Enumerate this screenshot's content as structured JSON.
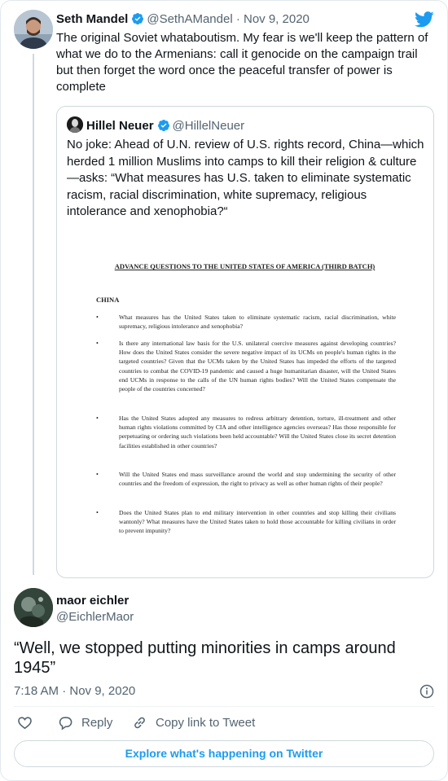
{
  "colors": {
    "accent": "#1d9bf0",
    "muted": "#536471",
    "text": "#0f1419",
    "border": "#cfd9de"
  },
  "parent_tweet": {
    "avatar_icon": "seth-mandel-avatar",
    "name": "Seth Mandel",
    "handle": "@SethAMandel",
    "dot": "·",
    "date": "Nov 9, 2020",
    "text": "The original Soviet whataboutism. My fear is we'll keep the pattern of what we do to the Armenians: call it genocide on the campaign trail but then forget the word once the peaceful transfer of power is complete"
  },
  "quoted_tweet": {
    "avatar_icon": "hillel-neuer-avatar",
    "name": "Hillel Neuer",
    "handle": "@HillelNeuer",
    "text": "No joke: Ahead of U.N. review of U.S. rights record, China—which herded 1 million Muslims into camps to kill their religion & culture—asks: “What measures has U.S. taken to eliminate systematic racism, racial discrimination, white supremacy, religious intolerance and xenophobia?“",
    "document": {
      "title": "ADVANCE QUESTIONS TO THE UNITED STATES OF AMERICA (THIRD BATCH)",
      "country": "CHINA",
      "bullet": "•",
      "items": [
        "What measures has the United States taken to eliminate systematic racism, racial discrimination, white supremacy, religious intolerance and xenophobia?",
        "Is there any international law basis for the U.S. unilateral coercive measures against developing countries? How does the United States consider the severe negative impact of its UCMs on people's human rights in the targeted countries? Given that the UCMs taken by the United States has impeded the efforts of the targeted countries to combat the COVID-19 pandemic and caused a huge humanitarian disaster, will the United States end UCMs in response to the calls of the UN human rights bodies? Will the United States compensate the people of the countries concerned?",
        "Has the United States adopted any measures to redress arbitrary detention, torture, ill-treatment and other human rights violations committed by CIA and other intelligence agencies overseas? Has those responsible for perpetuating or ordering such violations been held accountable? Will the United States close its secret detention facilities established in other countries?",
        "Will the United States end mass surveillance around the world and stop undermining the security of other countries and the freedom of expression, the right to privacy as well as other human rights of their people?",
        "Does the United States plan to end military intervention in other countries and stop killing their civilians wantonly? What measures have the United States taken to hold those accountable for killing civilians in order to prevent impunity?"
      ]
    }
  },
  "reply": {
    "avatar_icon": "maor-eichler-avatar",
    "name": "maor eichler",
    "handle": "@EichlerMaor",
    "text": "“Well, we stopped putting minorities in camps around 1945”",
    "timestamp": "7:18 AM · Nov 9, 2020"
  },
  "actions": {
    "reply_label": "Reply",
    "copy_link_label": "Copy link to Tweet"
  },
  "explore_label": "Explore what's happening on Twitter"
}
